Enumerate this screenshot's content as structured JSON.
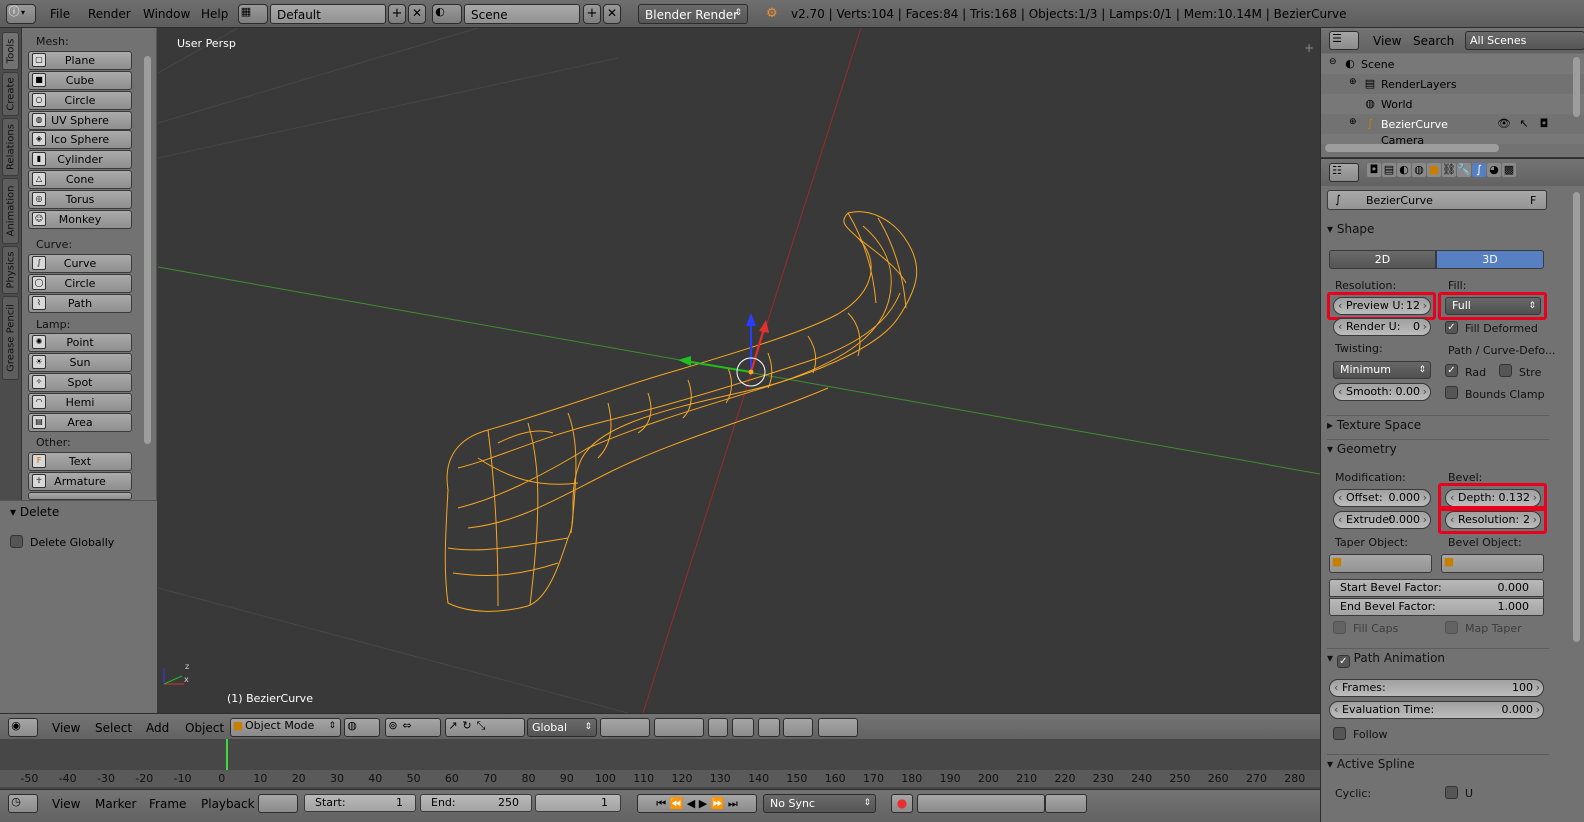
{
  "topbar": {
    "menus": [
      "File",
      "Render",
      "Window",
      "Help"
    ],
    "screen_layout": "Default",
    "scene": "Scene",
    "engine": "Blender Render",
    "stats": "v2.70 | Verts:104 | Faces:84 | Tris:168 | Objects:1/3 | Lamps:0/1 | Mem:10.14M | BezierCurve"
  },
  "toolshelf": {
    "tabs": [
      "Tools",
      "Create",
      "Relations",
      "Animation",
      "Physics",
      "Grease Pencil"
    ],
    "mesh_label": "Mesh:",
    "mesh": [
      "Plane",
      "Cube",
      "Circle",
      "UV Sphere",
      "Ico Sphere",
      "Cylinder",
      "Cone",
      "Torus",
      "Monkey"
    ],
    "curve_label": "Curve:",
    "curve": [
      "Curve",
      "Circle",
      "Path"
    ],
    "lamp_label": "Lamp:",
    "lamp": [
      "Point",
      "Sun",
      "Spot",
      "Hemi",
      "Area"
    ],
    "other_label": "Other:",
    "other": [
      "Text",
      "Armature"
    ]
  },
  "operator": {
    "title": "Delete",
    "option": "Delete Globally"
  },
  "viewport": {
    "view_name": "User Persp",
    "object_name": "(1) BezierCurve"
  },
  "viewport_header": {
    "menus": [
      "View",
      "Select",
      "Add",
      "Object"
    ],
    "mode": "Object Mode",
    "orientation": "Global"
  },
  "timeline": {
    "ticks": [
      "-50",
      "-40",
      "-30",
      "-20",
      "-10",
      "0",
      "10",
      "20",
      "30",
      "40",
      "50",
      "60",
      "70",
      "80",
      "90",
      "100",
      "110",
      "120",
      "130",
      "140",
      "150",
      "160",
      "170",
      "180",
      "190",
      "200",
      "210",
      "220",
      "230",
      "240",
      "250",
      "260",
      "270",
      "280"
    ],
    "menus": [
      "View",
      "Marker",
      "Frame",
      "Playback"
    ],
    "start_label": "Start:",
    "start": "1",
    "end_label": "End:",
    "end": "250",
    "current": "1",
    "sync": "No Sync"
  },
  "outliner": {
    "menus": [
      "View",
      "Search"
    ],
    "filter": "All Scenes",
    "items": [
      "Scene",
      "RenderLayers",
      "World",
      "BezierCurve",
      "Camera"
    ]
  },
  "properties": {
    "object_name": "BezierCurve",
    "fake_user": "F",
    "shape": {
      "title": "Shape",
      "mode_2d": "2D",
      "mode_3d": "3D",
      "resolution_label": "Resolution:",
      "preview_u_label": "Preview U:",
      "preview_u": "12",
      "render_u_label": "Render U:",
      "render_u": "0",
      "fill_label": "Fill:",
      "fill": "Full",
      "fill_deformed": "Fill Deformed",
      "twisting_label": "Twisting:",
      "twisting": "Minimum",
      "smooth_label": "Smooth:",
      "smooth": "0.00",
      "path_label": "Path / Curve-Defo...",
      "radius": "Rad",
      "stretch": "Stre",
      "bounds_clamp": "Bounds Clamp"
    },
    "texture_space": "Texture Space",
    "geometry": {
      "title": "Geometry",
      "modification_label": "Modification:",
      "offset_label": "Offset:",
      "offset": "0.000",
      "extrude_label": "Extrude:",
      "extrude": "0.000",
      "bevel_label": "Bevel:",
      "depth_label": "Depth:",
      "depth": "0.132",
      "resolution_label": "Resolution:",
      "resolution": "2",
      "taper_label": "Taper Object:",
      "bevel_object_label": "Bevel Object:",
      "start_bevel_label": "Start Bevel Factor:",
      "start_bevel": "0.000",
      "end_bevel_label": "End Bevel Factor:",
      "end_bevel": "1.000",
      "fill_caps": "Fill Caps",
      "map_taper": "Map Taper"
    },
    "path_animation": {
      "title": "Path Animation",
      "frames_label": "Frames:",
      "frames": "100",
      "eval_label": "Evaluation Time:",
      "eval": "0.000",
      "follow": "Follow"
    },
    "active_spline": {
      "title": "Active Spline",
      "cyclic_label": "Cyclic:",
      "u_label": "U"
    }
  },
  "colors": {
    "selection": "#f5a623",
    "highlight": "#e8001c",
    "active_blue": "#5680c2"
  }
}
